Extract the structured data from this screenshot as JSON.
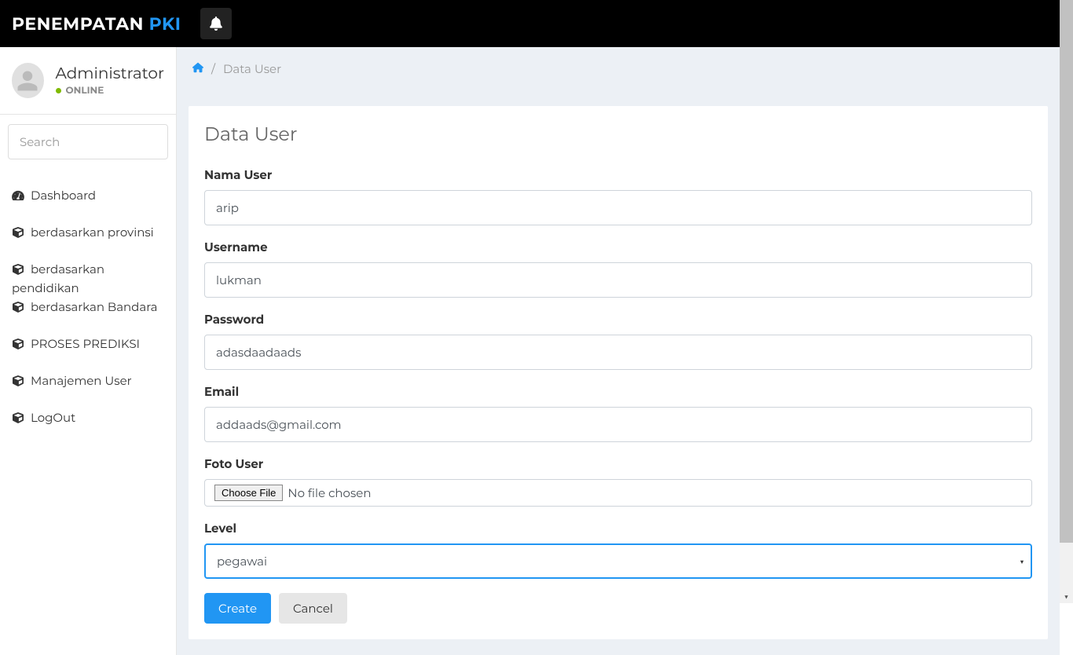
{
  "brand": {
    "main": "PENEMPATAN ",
    "sub": "PKI"
  },
  "user": {
    "name": "Administrator",
    "status": "ONLINE"
  },
  "search": {
    "placeholder": "Search"
  },
  "sidebar": {
    "items": [
      {
        "label": "Dashboard"
      },
      {
        "label": "berdasarkan provinsi"
      },
      {
        "label_line1": "berdasarkan",
        "label_line2": "pendidikan"
      },
      {
        "label": "berdasarkan Bandara"
      },
      {
        "label": "PROSES PREDIKSI"
      },
      {
        "label": "Manajemen User"
      },
      {
        "label": "LogOut"
      }
    ]
  },
  "breadcrumb": {
    "current": "Data User"
  },
  "card": {
    "title": "Data User"
  },
  "form": {
    "nama_user": {
      "label": "Nama User",
      "value": "arip"
    },
    "username": {
      "label": "Username",
      "value": "lukman"
    },
    "password": {
      "label": "Password",
      "value": "adasdaadaads"
    },
    "email": {
      "label": "Email",
      "value": "addaads@gmail.com"
    },
    "foto": {
      "label": "Foto User",
      "button": "Choose File",
      "text": "No file chosen"
    },
    "level": {
      "label": "Level",
      "value": "pegawai"
    },
    "buttons": {
      "create": "Create",
      "cancel": "Cancel"
    }
  }
}
